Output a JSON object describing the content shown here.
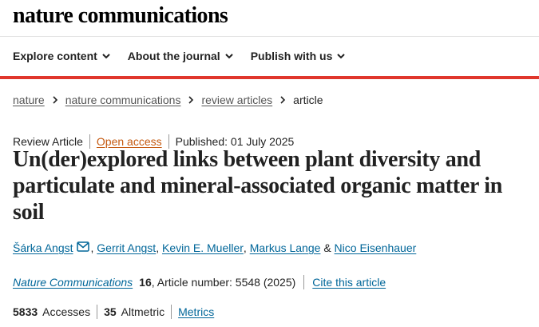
{
  "site": {
    "logo": "nature communications"
  },
  "nav": [
    {
      "label": "Explore content"
    },
    {
      "label": "About the journal"
    },
    {
      "label": "Publish with us"
    }
  ],
  "breadcrumb": {
    "items": [
      "nature",
      "nature communications",
      "review articles"
    ],
    "current": "article"
  },
  "article": {
    "type": "Review Article",
    "access": "Open access",
    "published": "Published: 01 July 2025",
    "title": "Un(der)explored links between plant diversity and particulate and mineral-associated organic matter in soil",
    "authors": [
      "Šárka Angst",
      "Gerrit Angst",
      "Kevin E. Mueller",
      "Markus Lange",
      "Nico Eisenhauer"
    ],
    "author_sep": ",",
    "author_and": "&",
    "journal": "Nature Communications",
    "volume": "16",
    "article_number": ", Article number: 5548 (2025)",
    "cite_label": "Cite this article"
  },
  "metrics": {
    "accesses_value": "5833",
    "accesses_label": "Accesses",
    "altmetric_value": "35",
    "altmetric_label": "Altmetric",
    "metrics_link": "Metrics"
  },
  "colors": {
    "accent_red": "#e0362c",
    "link_blue": "#006699",
    "open_access_orange": "#c55a11"
  },
  "icons": {
    "nav_dropdown": "chevron-down-icon",
    "breadcrumb_sep": "chevron-right-icon",
    "author_contact": "mail-icon"
  }
}
